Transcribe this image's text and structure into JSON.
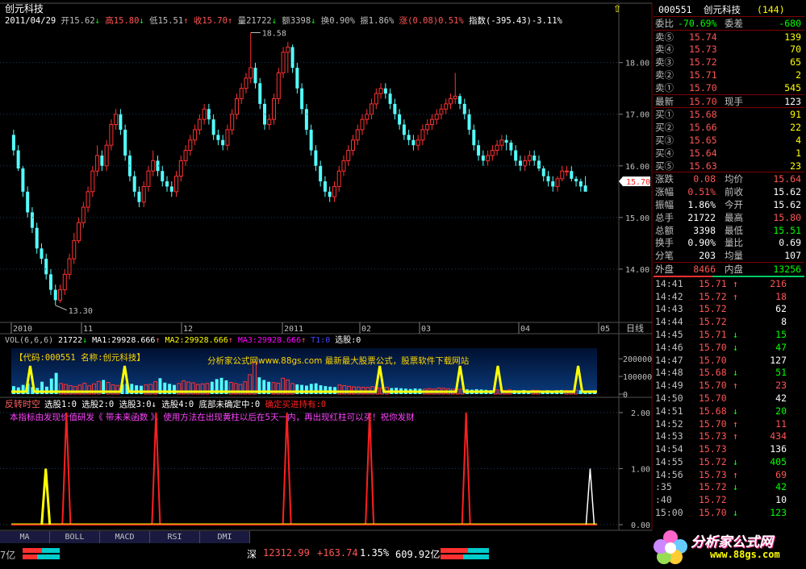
{
  "stock": {
    "name": "创元科技",
    "code": "000551",
    "count": "(144)",
    "info_line": [
      {
        "t": "2011/04/29",
        "c": "#ffffff"
      },
      {
        "t": " 开15.62",
        "c": "#c0c0c0"
      },
      {
        "t": "↓",
        "c": "#00ff00"
      },
      {
        "t": " 高15.80",
        "c": "#ff5555"
      },
      {
        "t": "↓",
        "c": "#00ff00"
      },
      {
        "t": " 低15.51",
        "c": "#c0c0c0"
      },
      {
        "t": "↑",
        "c": "#ff5555"
      },
      {
        "t": " 收15.70",
        "c": "#ff5555"
      },
      {
        "t": "↑",
        "c": "#ff5555"
      },
      {
        "t": " 量21722",
        "c": "#c0c0c0"
      },
      {
        "t": "↓",
        "c": "#00ff00"
      },
      {
        "t": " 额3398",
        "c": "#c0c0c0"
      },
      {
        "t": "↓",
        "c": "#00ff00"
      },
      {
        "t": " 换0.90%",
        "c": "#c0c0c0"
      },
      {
        "t": " 振1.86%",
        "c": "#c0c0c0"
      },
      {
        "t": " 涨(0.08)0.51%",
        "c": "#ff5555"
      },
      {
        "t": " 指数(-395.43)-3.11%",
        "c": "#ffffff"
      }
    ],
    "current_price_tag": "15.70"
  },
  "chart_data": [
    {
      "type": "candlestick",
      "title": "创元科技",
      "ylim": [
        13.0,
        18.9
      ],
      "y_ticks": [
        "14.00",
        "15.00",
        "16.00",
        "17.00",
        "18.00"
      ],
      "x_ticks": [
        "2010",
        "11",
        "12",
        "2011",
        "02",
        "03",
        "04",
        "05"
      ],
      "right_axis_label": "日线",
      "annotations": {
        "high": "18.58",
        "low": "13.30"
      },
      "close": [
        16.3,
        15.95,
        15.5,
        15.1,
        14.8,
        14.4,
        14.2,
        13.9,
        13.6,
        13.4,
        13.6,
        13.9,
        14.2,
        14.55,
        14.9,
        15.2,
        15.5,
        15.9,
        16.2,
        16.0,
        16.4,
        16.8,
        17.0,
        16.7,
        16.2,
        15.8,
        15.5,
        15.3,
        15.6,
        15.9,
        16.1,
        15.9,
        15.7,
        15.6,
        15.5,
        15.8,
        16.1,
        16.3,
        16.5,
        16.7,
        16.9,
        17.1,
        16.9,
        16.6,
        16.5,
        16.4,
        16.7,
        17.0,
        17.3,
        17.5,
        17.7,
        17.9,
        17.6,
        17.2,
        16.8,
        16.9,
        17.3,
        17.8,
        18.2,
        18.3,
        17.9,
        17.5,
        17.1,
        16.7,
        16.3,
        16.0,
        15.7,
        15.5,
        15.4,
        15.6,
        15.9,
        16.1,
        16.3,
        16.5,
        16.7,
        16.9,
        17.0,
        17.2,
        17.4,
        17.5,
        17.4,
        17.2,
        17.0,
        16.8,
        16.6,
        16.5,
        16.4,
        16.5,
        16.7,
        16.8,
        16.9,
        17.0,
        17.1,
        17.2,
        17.3,
        17.35,
        17.2,
        17.0,
        16.7,
        16.4,
        16.2,
        16.1,
        16.2,
        16.3,
        16.4,
        16.5,
        16.45,
        16.3,
        16.1,
        16.0,
        16.1,
        16.2,
        16.1,
        15.95,
        15.8,
        15.7,
        15.6,
        15.75,
        15.9,
        15.9,
        15.75,
        15.7,
        15.6,
        15.5,
        15.6,
        15.7
      ],
      "open": [
        16.6,
        16.3,
        15.95,
        15.5,
        15.1,
        14.8,
        14.4,
        14.2,
        13.9,
        13.6,
        13.4,
        13.6,
        13.9,
        14.2,
        14.55,
        14.9,
        15.2,
        15.5,
        15.9,
        16.2,
        16.0,
        16.4,
        16.8,
        17.0,
        16.7,
        16.2,
        15.8,
        15.5,
        15.3,
        15.6,
        15.9,
        16.1,
        15.9,
        15.7,
        15.6,
        15.5,
        15.8,
        16.1,
        16.3,
        16.5,
        16.7,
        16.9,
        17.1,
        16.9,
        16.6,
        16.5,
        16.4,
        16.7,
        17.0,
        17.3,
        17.5,
        17.7,
        17.9,
        17.6,
        17.2,
        16.8,
        16.9,
        17.3,
        17.8,
        18.2,
        18.3,
        17.9,
        17.5,
        17.1,
        16.7,
        16.3,
        16.0,
        15.7,
        15.5,
        15.4,
        15.6,
        15.9,
        16.1,
        16.3,
        16.5,
        16.7,
        16.9,
        17.0,
        17.2,
        17.4,
        17.5,
        17.4,
        17.2,
        17.0,
        16.8,
        16.6,
        16.5,
        16.4,
        16.5,
        16.7,
        16.8,
        16.9,
        17.0,
        17.1,
        17.2,
        17.3,
        17.35,
        17.2,
        17.0,
        16.7,
        16.4,
        16.2,
        16.1,
        16.2,
        16.3,
        16.4,
        16.5,
        16.45,
        16.3,
        16.1,
        16.0,
        16.1,
        16.2,
        16.1,
        15.95,
        15.8,
        15.7,
        15.6,
        15.75,
        15.9,
        15.9,
        15.75,
        15.7,
        15.62
      ],
      "high": [
        16.7,
        16.4,
        16.0,
        15.6,
        15.2,
        14.9,
        14.5,
        14.3,
        14.0,
        13.7,
        13.7,
        14.0,
        14.3,
        14.7,
        15.0,
        15.3,
        15.6,
        16.0,
        16.4,
        16.3,
        16.5,
        16.9,
        17.1,
        17.1,
        16.8,
        16.3,
        15.9,
        15.6,
        15.7,
        16.0,
        16.3,
        16.2,
        16.0,
        15.8,
        15.7,
        15.9,
        16.2,
        16.4,
        16.6,
        16.8,
        17.0,
        17.2,
        17.2,
        17.0,
        16.7,
        16.6,
        16.8,
        17.1,
        17.4,
        17.6,
        17.8,
        18.58,
        18.0,
        17.7,
        17.3,
        17.0,
        17.4,
        17.9,
        18.3,
        18.4,
        18.35,
        18.0,
        17.6,
        17.2,
        16.8,
        16.4,
        16.1,
        15.8,
        15.6,
        15.7,
        16.0,
        16.2,
        16.4,
        16.6,
        16.8,
        17.0,
        17.1,
        17.3,
        17.5,
        17.6,
        17.6,
        17.5,
        17.3,
        17.1,
        16.9,
        16.7,
        16.6,
        16.6,
        16.8,
        16.9,
        17.0,
        17.1,
        17.2,
        17.3,
        17.4,
        17.8,
        17.4,
        17.3,
        17.1,
        16.8,
        16.5,
        16.3,
        16.3,
        16.4,
        16.5,
        16.6,
        16.6,
        16.5,
        16.4,
        16.2,
        16.2,
        16.3,
        16.3,
        16.2,
        16.0,
        15.9,
        15.8,
        15.8,
        16.0,
        16.0,
        16.0,
        15.8,
        15.75,
        15.8
      ],
      "low": [
        16.2,
        15.9,
        15.4,
        15.0,
        14.7,
        14.3,
        14.1,
        13.8,
        13.5,
        13.3,
        13.35,
        13.5,
        13.8,
        14.1,
        14.5,
        14.8,
        15.1,
        15.4,
        15.8,
        15.9,
        15.9,
        16.3,
        16.7,
        16.6,
        16.1,
        15.7,
        15.4,
        15.2,
        15.2,
        15.5,
        15.8,
        15.8,
        15.6,
        15.5,
        15.4,
        15.4,
        15.7,
        16.0,
        16.2,
        16.4,
        16.6,
        16.8,
        16.8,
        16.5,
        16.4,
        16.3,
        16.3,
        16.6,
        16.9,
        17.2,
        17.4,
        17.6,
        17.5,
        17.1,
        16.7,
        16.7,
        16.8,
        17.2,
        17.7,
        17.8,
        17.8,
        17.4,
        17.0,
        16.6,
        16.2,
        15.9,
        15.6,
        15.4,
        15.3,
        15.3,
        15.5,
        15.8,
        16.0,
        16.2,
        16.4,
        16.6,
        16.8,
        16.9,
        17.1,
        17.3,
        17.3,
        17.1,
        16.9,
        16.7,
        16.5,
        16.4,
        16.3,
        16.3,
        16.4,
        16.6,
        16.7,
        16.8,
        16.9,
        17.0,
        17.1,
        17.2,
        17.1,
        16.9,
        16.6,
        16.3,
        16.1,
        16.0,
        16.0,
        16.1,
        16.2,
        16.3,
        16.3,
        16.2,
        16.0,
        15.9,
        15.9,
        16.0,
        16.0,
        15.9,
        15.7,
        15.6,
        15.5,
        15.5,
        15.7,
        15.8,
        15.7,
        15.6,
        15.5,
        15.51
      ]
    },
    {
      "type": "bar",
      "title": "VOL(6,6,6)",
      "legend": [
        {
          "t": "21722",
          "c": "#ffffff"
        },
        {
          "t": "↓",
          "c": "#00ff00"
        },
        {
          "t": " MA1:29928.666",
          "c": "#ffffff"
        },
        {
          "t": "↑",
          "c": "#ff5555"
        },
        {
          "t": " MA2:29928.666",
          "c": "#ffff00"
        },
        {
          "t": "↑",
          "c": "#ff5555"
        },
        {
          "t": " MA3:29928.666",
          "c": "#ff00ff"
        },
        {
          "t": "↑",
          "c": "#ff5555"
        },
        {
          "t": " T1:0",
          "c": "#4444ff"
        },
        {
          "t": " 选股:0",
          "c": "#ffffff"
        }
      ],
      "ylim": [
        0,
        260000
      ],
      "y_ticks": [
        "200000",
        "100000",
        "0"
      ],
      "watermark": "【代码:000551 名称:创元科技】",
      "watermark2": "分析家公式网www.88gs.com 最新最大股票公式，股票软件下载网站",
      "volumes": [
        45000,
        38000,
        52000,
        61000,
        40000,
        35000,
        70000,
        42000,
        88000,
        120000,
        60000,
        55000,
        48000,
        43000,
        51000,
        62000,
        47000,
        58000,
        72000,
        80000,
        66000,
        52000,
        49000,
        55000,
        60000,
        58000,
        50000,
        47000,
        52000,
        55000,
        70000,
        90000,
        65000,
        58000,
        52000,
        60000,
        75000,
        68000,
        64000,
        55000,
        58000,
        60000,
        70000,
        85000,
        92000,
        78000,
        66000,
        60000,
        55000,
        70000,
        110000,
        180000,
        95000,
        80000,
        70000,
        65000,
        62000,
        90000,
        80000,
        60000,
        55000,
        52000,
        48000,
        58000,
        61000,
        50000,
        45000,
        42000,
        40000,
        52000,
        48000,
        44000,
        41000,
        40000,
        39000,
        38000,
        42000,
        36000,
        35000,
        38000,
        34000,
        36000,
        33000,
        31000,
        29000,
        32000,
        30000,
        28000,
        31000,
        29000,
        35000,
        33000,
        30000,
        28000,
        26000,
        29000,
        27000,
        25000,
        28000,
        26000,
        24000,
        22000,
        25000,
        23000,
        21000,
        24000,
        22000,
        21000,
        23000,
        20000,
        22000,
        21000,
        19000,
        22000,
        20000,
        21722,
        23000,
        21000,
        20000,
        22000,
        21722,
        20000,
        21000,
        21722
      ],
      "signal_pulses": [
        4,
        24,
        78,
        95,
        103,
        120
      ]
    },
    {
      "type": "line",
      "title": "反转时空",
      "legend": [
        {
          "t": " 选股1:0",
          "c": "#ffffff"
        },
        {
          "t": " 选股2:0",
          "c": "#ffffff"
        },
        {
          "t": " 选股3:0",
          "c": "#ffffff"
        },
        {
          "t": "↓",
          "c": "#ffffff"
        },
        {
          "t": " 选股4:0",
          "c": "#ffffff"
        },
        {
          "t": " 底部未确定中:0",
          "c": "#ffffff"
        },
        {
          "t": " 确定买进持有:0",
          "c": "#ff2020"
        }
      ],
      "note": "本指标由发现价值研发《 带未来函数 》，使用方法在出现黄柱以后在5天一内，再出现红柱可以买！祝你发财",
      "ylim": [
        0,
        2.2
      ],
      "y_ticks": [
        "2.00",
        "1.00",
        "0.00"
      ],
      "yellow_spikes": [
        {
          "x": 5,
          "v": 1.0
        }
      ],
      "red_spikes": [
        {
          "x": 8,
          "v": 2.0
        },
        {
          "x": 21,
          "v": 2.0
        },
        {
          "x": 40,
          "v": 2.0
        },
        {
          "x": 52,
          "v": 2.0
        },
        {
          "x": 66,
          "v": 2.0
        }
      ],
      "white_spikes": [
        {
          "x": 84,
          "v": 1.0
        }
      ],
      "x_count": 85
    }
  ],
  "order_book": {
    "title_code": "000551",
    "title_name": "创元科技",
    "title_count": "(144)",
    "weibi": {
      "label": "委比",
      "value": "-70.69%",
      "label2": "委差",
      "value2": "-680"
    },
    "sells": [
      {
        "label": "卖⑤",
        "price": "15.74",
        "vol": "139"
      },
      {
        "label": "卖④",
        "price": "15.73",
        "vol": "70"
      },
      {
        "label": "卖③",
        "price": "15.72",
        "vol": "65"
      },
      {
        "label": "卖②",
        "price": "15.71",
        "vol": "2"
      },
      {
        "label": "卖①",
        "price": "15.70",
        "vol": "545"
      }
    ],
    "latest": {
      "label": "最新",
      "price": "15.70",
      "label2": "现手",
      "vol": "123"
    },
    "buys": [
      {
        "label": "买①",
        "price": "15.68",
        "vol": "91"
      },
      {
        "label": "买②",
        "price": "15.66",
        "vol": "22"
      },
      {
        "label": "买③",
        "price": "15.65",
        "vol": "4"
      },
      {
        "label": "买④",
        "price": "15.64",
        "vol": "1"
      },
      {
        "label": "买⑤",
        "price": "15.63",
        "vol": "23"
      }
    ],
    "stats": [
      {
        "l1": "涨跌",
        "v1": "0.08",
        "c1": "#ff5555",
        "l2": "均价",
        "v2": "15.64",
        "c2": "#ff5555"
      },
      {
        "l1": "涨幅",
        "v1": "0.51%",
        "c1": "#ff5555",
        "l2": "前收",
        "v2": "15.62",
        "c2": "#ffffff"
      },
      {
        "l1": "振幅",
        "v1": "1.86%",
        "c1": "#ffffff",
        "l2": "今开",
        "v2": "15.62",
        "c2": "#ffffff"
      },
      {
        "l1": "总手",
        "v1": "21722",
        "c1": "#ffffff",
        "l2": "最高",
        "v2": "15.80",
        "c2": "#ff5555"
      },
      {
        "l1": "总额",
        "v1": "3398",
        "c1": "#ffffff",
        "l2": "最低",
        "v2": "15.51",
        "c2": "#00ff00"
      },
      {
        "l1": "换手",
        "v1": "0.90%",
        "c1": "#ffffff",
        "l2": "量比",
        "v2": "0.69",
        "c2": "#ffffff"
      },
      {
        "l1": "分笔",
        "v1": "203",
        "c1": "#ffffff",
        "l2": "均量",
        "v2": "107",
        "c2": "#ffffff"
      }
    ],
    "outer": {
      "label": "外盘",
      "value": "8466",
      "label2": "内盘",
      "value2": "13256"
    },
    "ticks": [
      {
        "time": "14:41",
        "price": "15.71",
        "arrow": "↑",
        "vol": "216"
      },
      {
        "time": "14:42",
        "price": "15.72",
        "arrow": "↑",
        "vol": "18"
      },
      {
        "time": "14:43",
        "price": "15.72",
        "arrow": "",
        "vol": "62"
      },
      {
        "time": "14:44",
        "price": "15.72",
        "arrow": "",
        "vol": "8"
      },
      {
        "time": "14:45",
        "price": "15.71",
        "arrow": "↓",
        "vol": "15"
      },
      {
        "time": "14:46",
        "price": "15.70",
        "arrow": "↓",
        "vol": "47"
      },
      {
        "time": "14:47",
        "price": "15.70",
        "arrow": "",
        "vol": "127"
      },
      {
        "time": "14:48",
        "price": "15.68",
        "arrow": "↓",
        "vol": "51"
      },
      {
        "time": "14:49",
        "price": "15.70",
        "arrow": "↑",
        "vol": "23"
      },
      {
        "time": "14:50",
        "price": "15.70",
        "arrow": "",
        "vol": "42"
      },
      {
        "time": "14:51",
        "price": "15.68",
        "arrow": "↓",
        "vol": "20"
      },
      {
        "time": "14:52",
        "price": "15.70",
        "arrow": "↑",
        "vol": "11"
      },
      {
        "time": "14:53",
        "price": "15.73",
        "arrow": "↑",
        "vol": "434"
      },
      {
        "time": "14:54",
        "price": "15.73",
        "arrow": "",
        "vol": "136"
      },
      {
        "time": "14:55",
        "price": "15.72",
        "arrow": "↓",
        "vol": "405"
      },
      {
        "time": "14:56",
        "price": "15.73",
        "arrow": "↑",
        "vol": "69"
      },
      {
        "time": ":35",
        "price": "15.72",
        "arrow": "↓",
        "vol": "42"
      },
      {
        "time": ":40",
        "price": "15.72",
        "arrow": "",
        "vol": "10"
      },
      {
        "time": "15:00",
        "price": "15.70",
        "arrow": "↓",
        "vol": "123"
      }
    ]
  },
  "tabs": [
    "MA",
    "BOLL",
    "MACD",
    "RSI",
    "DMI"
  ],
  "footer": {
    "left_text": "7亿",
    "market_label": "深",
    "index_value": "12312.99",
    "index_change": "+163.74",
    "index_pct": "1.35%",
    "index_amount": "609.92亿"
  },
  "logo": {
    "text": "分析家公式网",
    "url_text": "www.88gs.com"
  }
}
